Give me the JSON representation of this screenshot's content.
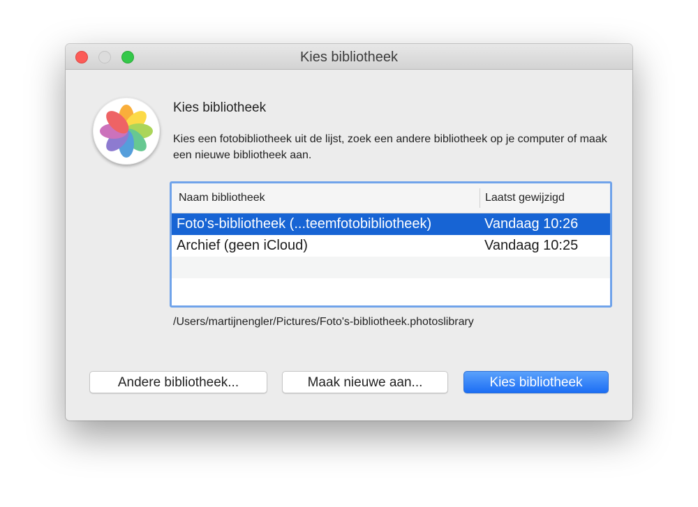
{
  "window": {
    "title": "Kies bibliotheek"
  },
  "dialog": {
    "heading": "Kies bibliotheek",
    "description": "Kies een fotobibliotheek uit de lijst, zoek een andere bibliotheek op je computer of maak een nieuwe bibliotheek aan.",
    "icon": "photos-app-icon"
  },
  "table": {
    "columns": {
      "name": "Naam bibliotheek",
      "modified": "Laatst gewijzigd"
    },
    "rows": [
      {
        "name": "Foto's-bibliotheek (...teemfotobibliotheek)",
        "modified": "Vandaag 10:26",
        "selected": true
      },
      {
        "name": "Archief (geen iCloud)",
        "modified": "Vandaag 10:25",
        "selected": false
      }
    ]
  },
  "path": "/Users/martijnengler/Pictures/Foto's-bibliotheek.photoslibrary",
  "buttons": {
    "other": "Andere bibliotheek...",
    "create": "Maak nieuwe aan...",
    "choose": "Kies bibliotheek"
  },
  "colors": {
    "selection": "#1764d4",
    "focus_ring": "#70a3ea",
    "primary_button": "#1c6ef4"
  }
}
